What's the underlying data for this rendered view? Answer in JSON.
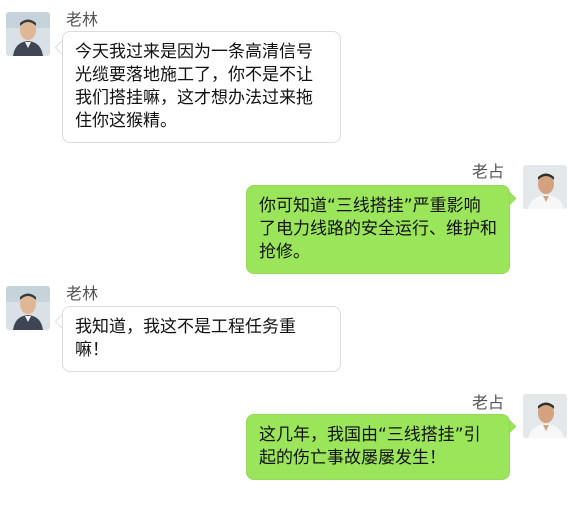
{
  "messages": [
    {
      "sender": "老林",
      "side": "left",
      "text": "今天我过来是因为一条高清信号光缆要落地施工了，你不是不让我们搭挂嘛，这才想办法过来拖住你这猴精。"
    },
    {
      "sender": "老占",
      "side": "right",
      "text": "你可知道“三线搭挂”严重影响了电力线路的安全运行、维护和抢修。"
    },
    {
      "sender": "老林",
      "side": "left",
      "text": "我知道，我这不是工程任务重嘛！"
    },
    {
      "sender": "老占",
      "side": "right",
      "text": "这几年，我国由“三线搭挂”引起的伤亡事故屡屡发生！"
    }
  ],
  "colors": {
    "right_bubble": "#9be55b",
    "left_bubble": "#ffffff",
    "page_background": "#ffffff"
  },
  "icons": {
    "left_avatar": "avatar-icon",
    "right_avatar": "avatar-icon"
  }
}
